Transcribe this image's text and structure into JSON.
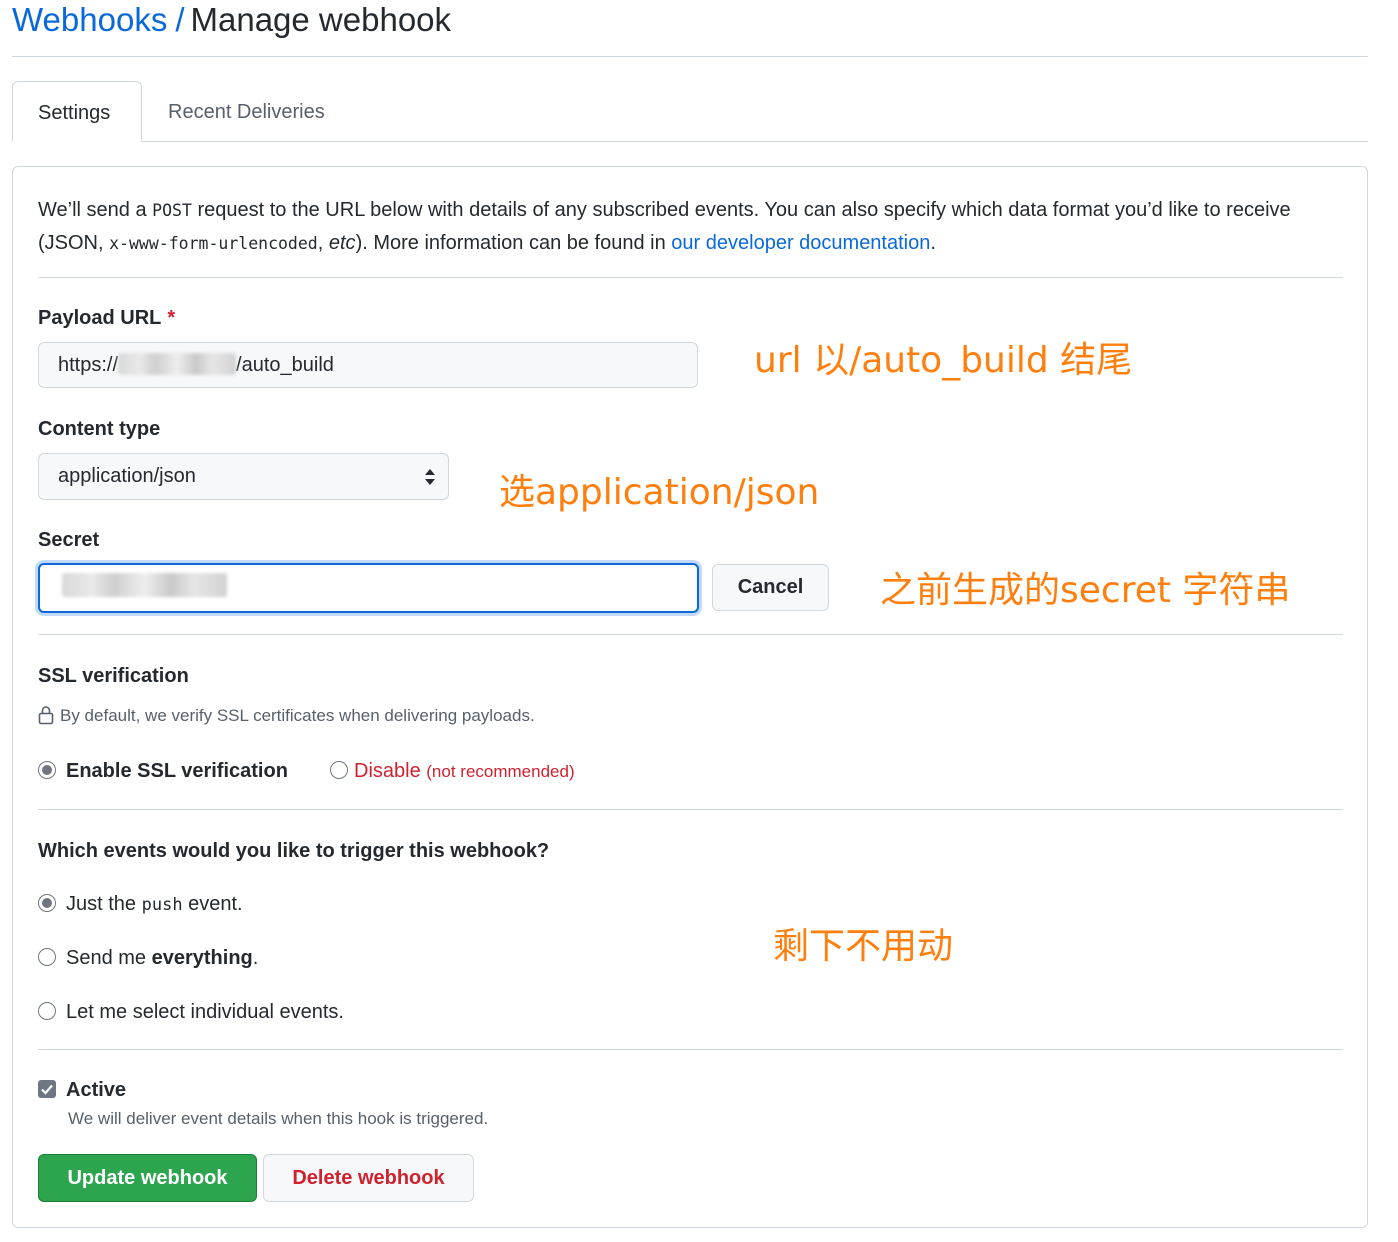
{
  "breadcrumb": {
    "parent": "Webhooks",
    "separator": "/",
    "current": "Manage webhook"
  },
  "tabs": [
    {
      "label": "Settings",
      "active": true
    },
    {
      "label": "Recent Deliveries",
      "active": false
    }
  ],
  "intro": {
    "part1": "We’ll send a ",
    "code_post": "POST",
    "part2": " request to the URL below with details of any subscribed events. You can also specify which data format you’d like to receive (JSON, ",
    "code_form": "x-www-form-urlencoded",
    "part3": ", ",
    "etc": "etc",
    "part4": "). More information can be found in ",
    "link": "our developer documentation",
    "part5": "."
  },
  "payload_url": {
    "label": "Payload URL",
    "required_mark": "*",
    "value_prefix": "https://",
    "value_suffix": "/auto_build"
  },
  "content_type": {
    "label": "Content type",
    "selected": "application/json"
  },
  "secret": {
    "label": "Secret",
    "cancel_label": "Cancel"
  },
  "ssl": {
    "label": "SSL verification",
    "note": "By default, we verify SSL certificates when delivering payloads.",
    "enable_label": "Enable SSL verification",
    "disable_label": "Disable",
    "disable_note": "(not recommended)",
    "selected": "enable"
  },
  "events": {
    "question": "Which events would you like to trigger this webhook?",
    "opt_push_a": "Just the ",
    "opt_push_code": "push",
    "opt_push_b": " event.",
    "opt_all_a": "Send me ",
    "opt_all_bold": "everything",
    "opt_all_b": ".",
    "opt_select": "Let me select individual events.",
    "selected": "push"
  },
  "active": {
    "label": "Active",
    "checked": true,
    "hint": "We will deliver event details when this hook is triggered."
  },
  "actions": {
    "update_label": "Update webhook",
    "delete_label": "Delete webhook"
  },
  "annotations": {
    "url_note": "url 以/auto_build 结尾",
    "content_note": "选application/json",
    "secret_note": "之前生成的secret 字符串",
    "rest_note": "剩下不用动"
  },
  "colors": {
    "link": "#0969da",
    "danger": "#cf222e",
    "primary_button": "#2da44e",
    "annotation": "#ff7f0e",
    "focus_border": "#0969da"
  }
}
